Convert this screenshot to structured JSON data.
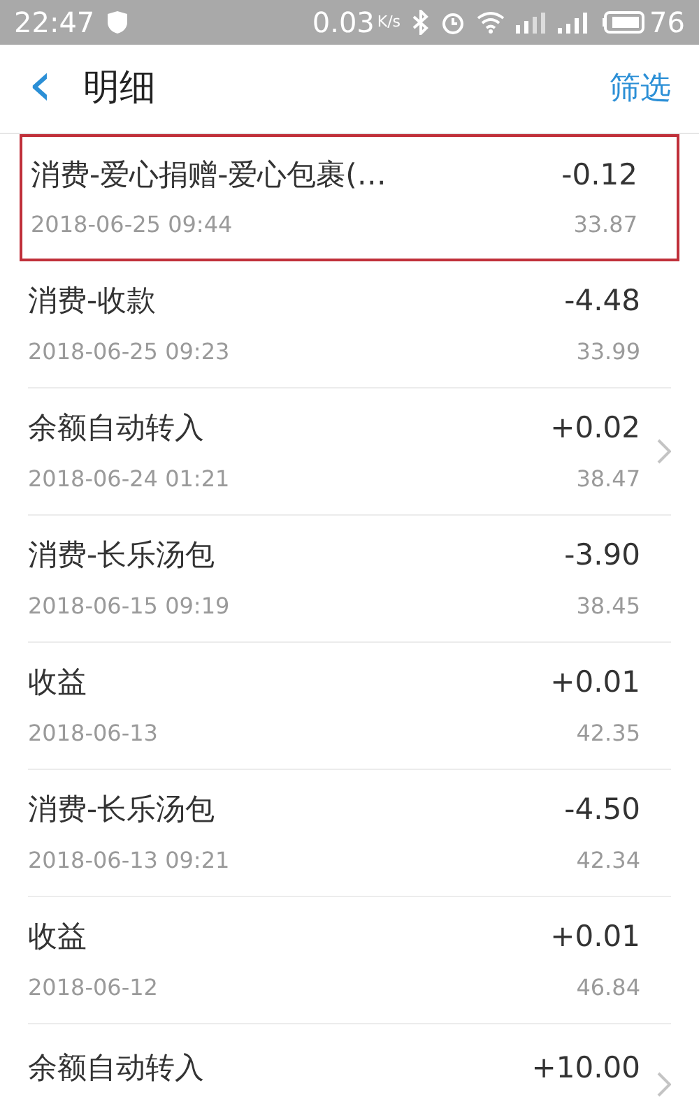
{
  "status_bar": {
    "time": "22:47",
    "speed": "0.03",
    "speed_unit": "K/s",
    "battery": "76"
  },
  "header": {
    "back": "‹",
    "title": "明细",
    "action": "筛选"
  },
  "rows": [
    {
      "title": "消费-爱心捐赠-爱心包裹(…",
      "date": "2018-06-25 09:44",
      "amount": "-0.12",
      "balance": "33.87",
      "highlighted": true,
      "chevron": false
    },
    {
      "title": "消费-收款",
      "date": "2018-06-25 09:23",
      "amount": "-4.48",
      "balance": "33.99",
      "highlighted": false,
      "chevron": false
    },
    {
      "title": "余额自动转入",
      "date": "2018-06-24 01:21",
      "amount": "+0.02",
      "balance": "38.47",
      "highlighted": false,
      "chevron": true
    },
    {
      "title": "消费-长乐汤包",
      "date": "2018-06-15 09:19",
      "amount": "-3.90",
      "balance": "38.45",
      "highlighted": false,
      "chevron": false
    },
    {
      "title": "收益",
      "date": "2018-06-13",
      "amount": "+0.01",
      "balance": "42.35",
      "highlighted": false,
      "chevron": false
    },
    {
      "title": "消费-长乐汤包",
      "date": "2018-06-13 09:21",
      "amount": "-4.50",
      "balance": "42.34",
      "highlighted": false,
      "chevron": false
    },
    {
      "title": "收益",
      "date": "2018-06-12",
      "amount": "+0.01",
      "balance": "46.84",
      "highlighted": false,
      "chevron": false
    },
    {
      "title": "余额自动转入",
      "amount": "+10.00",
      "highlighted": false,
      "chevron": true
    }
  ]
}
